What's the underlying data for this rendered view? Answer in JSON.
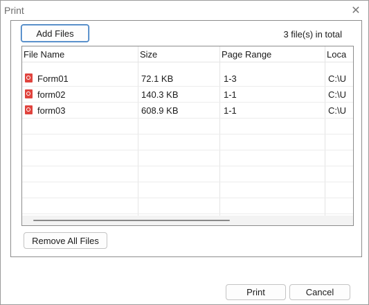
{
  "window": {
    "title": "Print",
    "close_glyph": "✕"
  },
  "toolbar": {
    "add_files_label": "Add Files",
    "file_count": "3 file(s) in total"
  },
  "table": {
    "headers": [
      "File Name",
      "Size",
      "Page Range",
      "Loca"
    ],
    "rows": [
      {
        "name": "Form01",
        "size": "72.1 KB",
        "range": "1-3",
        "location": "C:\\U"
      },
      {
        "name": "form02",
        "size": "140.3 KB",
        "range": "1-1",
        "location": "C:\\U"
      },
      {
        "name": "form03",
        "size": "608.9 KB",
        "range": "1-1",
        "location": "C:\\U"
      }
    ]
  },
  "actions": {
    "remove_all_label": "Remove All Files",
    "print_label": "Print",
    "cancel_label": "Cancel"
  },
  "colors": {
    "accent": "#2a6fb7",
    "pdf_icon": "#e0443e"
  },
  "icons": {
    "file": "pdf-file-icon",
    "close": "close-icon"
  }
}
